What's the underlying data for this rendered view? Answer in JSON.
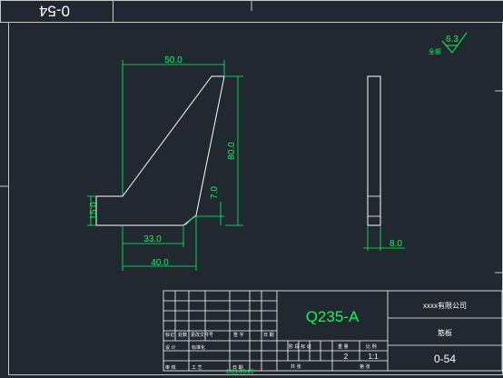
{
  "drawing": {
    "number_rotated": "0-54",
    "roughness_value": "6.3",
    "roughness_prefix": "全部",
    "dimensions": {
      "top_width": "50.0",
      "height": "80.0",
      "left_height": "15.0",
      "step_height": "7.0",
      "bottom_inner": "33.0",
      "bottom_total": "40.0",
      "thickness": "8.0"
    }
  },
  "title_block": {
    "material": "Q235-A",
    "company": "xxxx有限公司",
    "part_name": "筋板",
    "drawing_number": "0-54",
    "quantity": "2",
    "scale": "1:1",
    "row_labels": [
      "标记",
      "处数",
      "更改文件号",
      "签 字",
      "日 期"
    ],
    "bottom_labels": [
      "设 计",
      "标准化",
      "审 核",
      "工 艺",
      "日 期"
    ],
    "date": "2021-05-25",
    "stage_header": [
      "阶 段 标 记",
      "重 量",
      "比 例"
    ],
    "sheet_labels": [
      "共 张",
      "第 张"
    ]
  },
  "colors": {
    "background": "#212830",
    "line": "#ffffff",
    "dimension": "#00ff5a"
  }
}
